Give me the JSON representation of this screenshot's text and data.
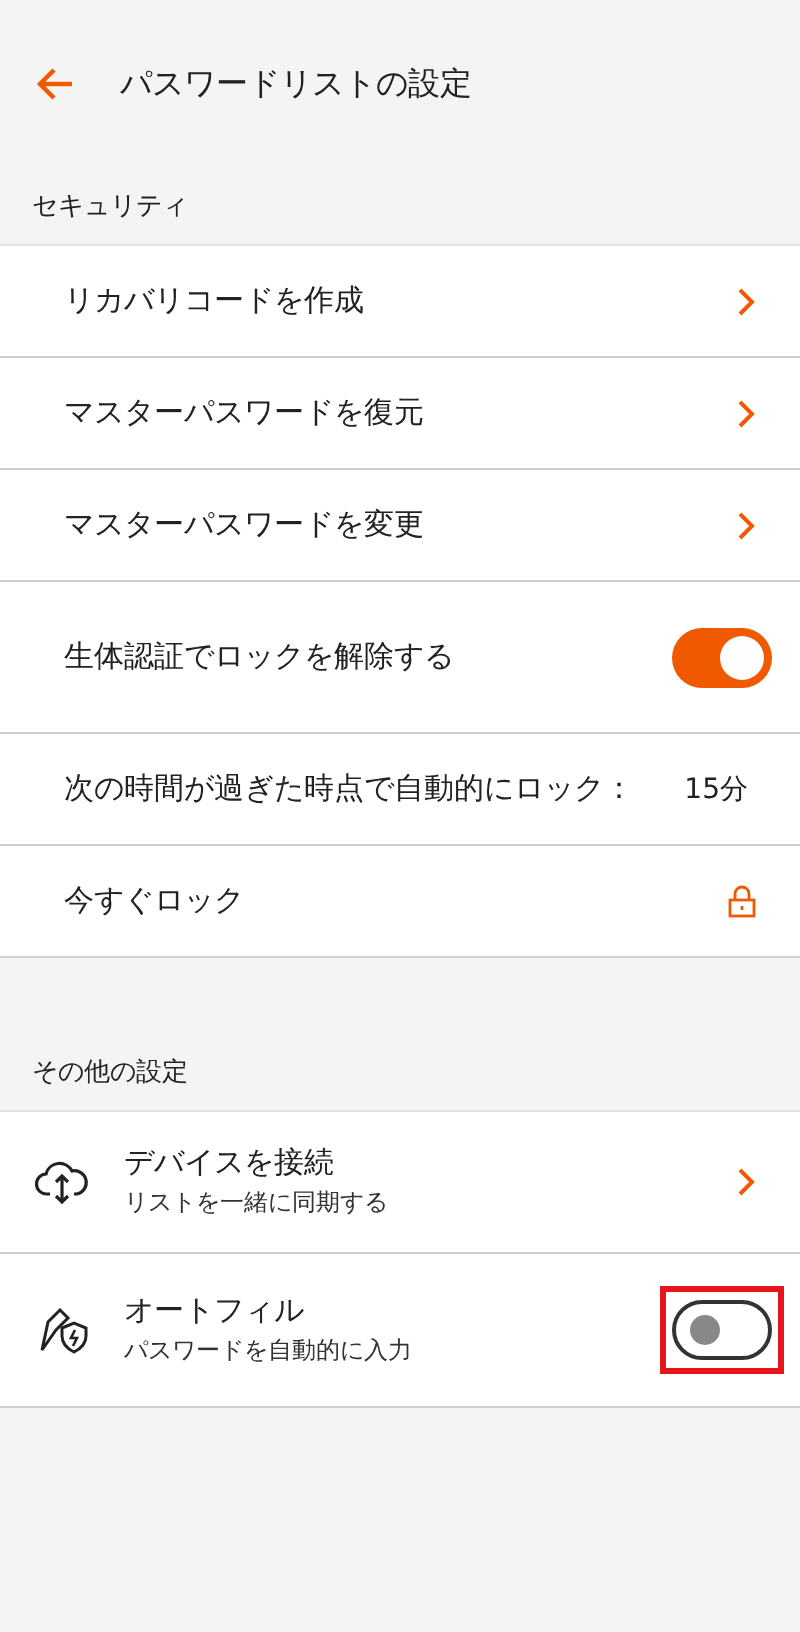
{
  "header": {
    "title": "パスワードリストの設定"
  },
  "sections": [
    {
      "title": "セキュリティ",
      "items": [
        {
          "kind": "link",
          "label": "リカバリコードを作成"
        },
        {
          "kind": "link",
          "label": "マスターパスワードを復元"
        },
        {
          "kind": "link",
          "label": "マスターパスワードを変更"
        },
        {
          "kind": "toggle",
          "label": "生体認証でロックを解除する",
          "on": true,
          "highlighted": false
        },
        {
          "kind": "value",
          "label": "次の時間が過ぎた時点で自動的にロック：",
          "value": "15分"
        },
        {
          "kind": "lock",
          "label": "今すぐロック"
        }
      ]
    },
    {
      "title": "その他の設定",
      "items": [
        {
          "kind": "link",
          "label": "デバイスを接続",
          "subtitle": "リストを一緒に同期する"
        },
        {
          "kind": "toggle",
          "label": "オートフィル",
          "subtitle": "パスワードを自動的に入力",
          "on": false,
          "highlighted": true
        }
      ]
    }
  ]
}
